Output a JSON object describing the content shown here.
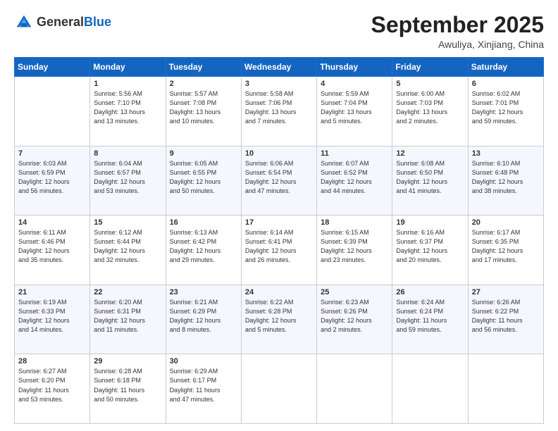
{
  "header": {
    "logo_general": "General",
    "logo_blue": "Blue",
    "month": "September 2025",
    "location": "Awuliya, Xinjiang, China"
  },
  "weekdays": [
    "Sunday",
    "Monday",
    "Tuesday",
    "Wednesday",
    "Thursday",
    "Friday",
    "Saturday"
  ],
  "weeks": [
    [
      {
        "day": "",
        "info": ""
      },
      {
        "day": "1",
        "info": "Sunrise: 5:56 AM\nSunset: 7:10 PM\nDaylight: 13 hours\nand 13 minutes."
      },
      {
        "day": "2",
        "info": "Sunrise: 5:57 AM\nSunset: 7:08 PM\nDaylight: 13 hours\nand 10 minutes."
      },
      {
        "day": "3",
        "info": "Sunrise: 5:58 AM\nSunset: 7:06 PM\nDaylight: 13 hours\nand 7 minutes."
      },
      {
        "day": "4",
        "info": "Sunrise: 5:59 AM\nSunset: 7:04 PM\nDaylight: 13 hours\nand 5 minutes."
      },
      {
        "day": "5",
        "info": "Sunrise: 6:00 AM\nSunset: 7:03 PM\nDaylight: 13 hours\nand 2 minutes."
      },
      {
        "day": "6",
        "info": "Sunrise: 6:02 AM\nSunset: 7:01 PM\nDaylight: 12 hours\nand 59 minutes."
      }
    ],
    [
      {
        "day": "7",
        "info": "Sunrise: 6:03 AM\nSunset: 6:59 PM\nDaylight: 12 hours\nand 56 minutes."
      },
      {
        "day": "8",
        "info": "Sunrise: 6:04 AM\nSunset: 6:57 PM\nDaylight: 12 hours\nand 53 minutes."
      },
      {
        "day": "9",
        "info": "Sunrise: 6:05 AM\nSunset: 6:55 PM\nDaylight: 12 hours\nand 50 minutes."
      },
      {
        "day": "10",
        "info": "Sunrise: 6:06 AM\nSunset: 6:54 PM\nDaylight: 12 hours\nand 47 minutes."
      },
      {
        "day": "11",
        "info": "Sunrise: 6:07 AM\nSunset: 6:52 PM\nDaylight: 12 hours\nand 44 minutes."
      },
      {
        "day": "12",
        "info": "Sunrise: 6:08 AM\nSunset: 6:50 PM\nDaylight: 12 hours\nand 41 minutes."
      },
      {
        "day": "13",
        "info": "Sunrise: 6:10 AM\nSunset: 6:48 PM\nDaylight: 12 hours\nand 38 minutes."
      }
    ],
    [
      {
        "day": "14",
        "info": "Sunrise: 6:11 AM\nSunset: 6:46 PM\nDaylight: 12 hours\nand 35 minutes."
      },
      {
        "day": "15",
        "info": "Sunrise: 6:12 AM\nSunset: 6:44 PM\nDaylight: 12 hours\nand 32 minutes."
      },
      {
        "day": "16",
        "info": "Sunrise: 6:13 AM\nSunset: 6:42 PM\nDaylight: 12 hours\nand 29 minutes."
      },
      {
        "day": "17",
        "info": "Sunrise: 6:14 AM\nSunset: 6:41 PM\nDaylight: 12 hours\nand 26 minutes."
      },
      {
        "day": "18",
        "info": "Sunrise: 6:15 AM\nSunset: 6:39 PM\nDaylight: 12 hours\nand 23 minutes."
      },
      {
        "day": "19",
        "info": "Sunrise: 6:16 AM\nSunset: 6:37 PM\nDaylight: 12 hours\nand 20 minutes."
      },
      {
        "day": "20",
        "info": "Sunrise: 6:17 AM\nSunset: 6:35 PM\nDaylight: 12 hours\nand 17 minutes."
      }
    ],
    [
      {
        "day": "21",
        "info": "Sunrise: 6:19 AM\nSunset: 6:33 PM\nDaylight: 12 hours\nand 14 minutes."
      },
      {
        "day": "22",
        "info": "Sunrise: 6:20 AM\nSunset: 6:31 PM\nDaylight: 12 hours\nand 11 minutes."
      },
      {
        "day": "23",
        "info": "Sunrise: 6:21 AM\nSunset: 6:29 PM\nDaylight: 12 hours\nand 8 minutes."
      },
      {
        "day": "24",
        "info": "Sunrise: 6:22 AM\nSunset: 6:28 PM\nDaylight: 12 hours\nand 5 minutes."
      },
      {
        "day": "25",
        "info": "Sunrise: 6:23 AM\nSunset: 6:26 PM\nDaylight: 12 hours\nand 2 minutes."
      },
      {
        "day": "26",
        "info": "Sunrise: 6:24 AM\nSunset: 6:24 PM\nDaylight: 11 hours\nand 59 minutes."
      },
      {
        "day": "27",
        "info": "Sunrise: 6:26 AM\nSunset: 6:22 PM\nDaylight: 11 hours\nand 56 minutes."
      }
    ],
    [
      {
        "day": "28",
        "info": "Sunrise: 6:27 AM\nSunset: 6:20 PM\nDaylight: 11 hours\nand 53 minutes."
      },
      {
        "day": "29",
        "info": "Sunrise: 6:28 AM\nSunset: 6:18 PM\nDaylight: 11 hours\nand 50 minutes."
      },
      {
        "day": "30",
        "info": "Sunrise: 6:29 AM\nSunset: 6:17 PM\nDaylight: 11 hours\nand 47 minutes."
      },
      {
        "day": "",
        "info": ""
      },
      {
        "day": "",
        "info": ""
      },
      {
        "day": "",
        "info": ""
      },
      {
        "day": "",
        "info": ""
      }
    ]
  ]
}
